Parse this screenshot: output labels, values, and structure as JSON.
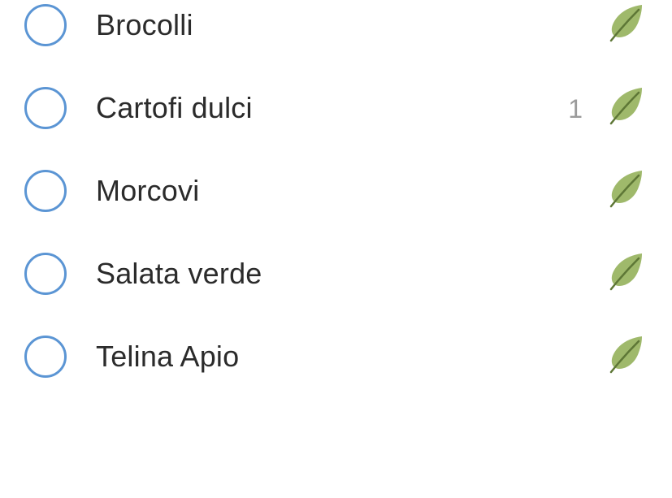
{
  "items": [
    {
      "label": "Brocolli",
      "count": "",
      "icon": "leaf-icon"
    },
    {
      "label": "Cartofi dulci",
      "count": "1",
      "icon": "leaf-icon"
    },
    {
      "label": "Morcovi",
      "count": "",
      "icon": "leaf-icon"
    },
    {
      "label": "Salata verde",
      "count": "",
      "icon": "leaf-icon"
    },
    {
      "label": "Telina Apio",
      "count": "",
      "icon": "leaf-icon"
    }
  ],
  "colors": {
    "checkbox_border": "#5b95d4",
    "leaf_fill": "#9fb96b",
    "leaf_vein": "#5e7736",
    "text": "#2b2b2b",
    "count_text": "#9b9b9b"
  }
}
